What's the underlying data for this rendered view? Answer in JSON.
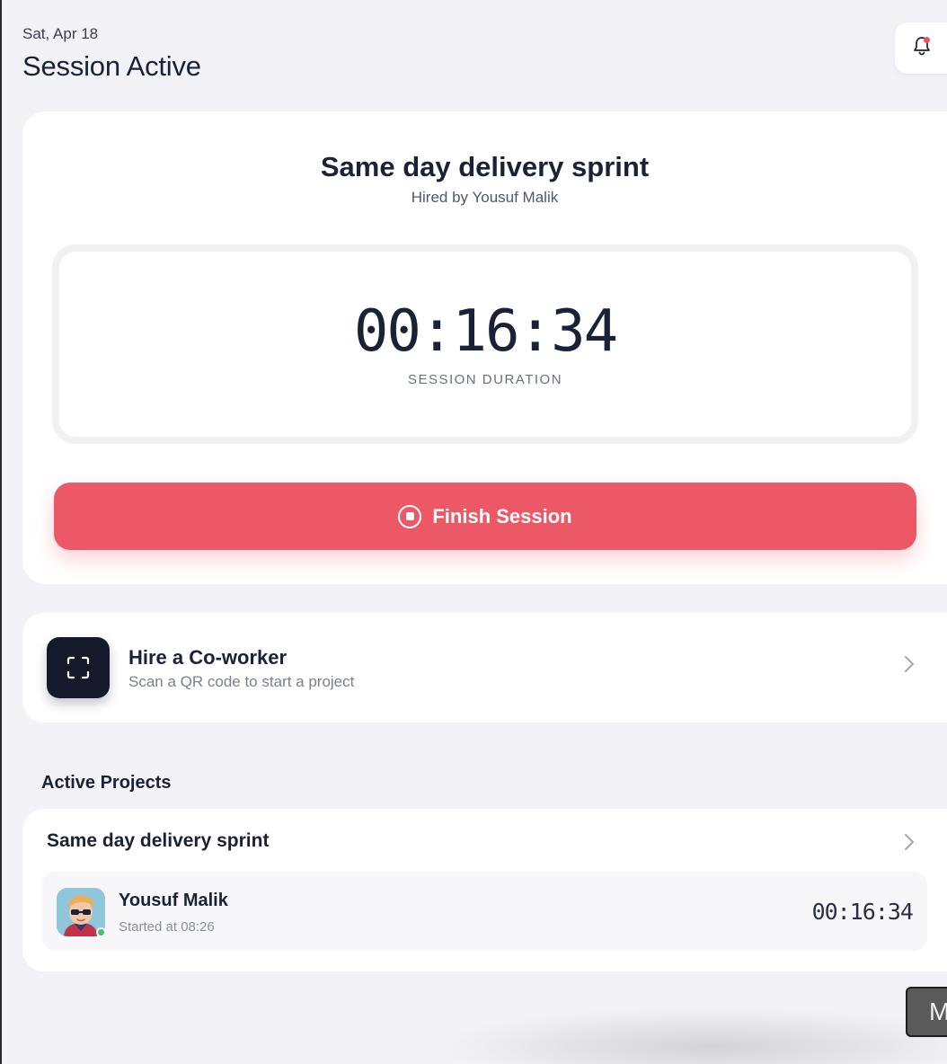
{
  "header": {
    "date": "Sat, Apr 18",
    "title": "Session Active"
  },
  "session": {
    "project_title": "Same day delivery sprint",
    "hired_by": "Hired by Yousuf Malik",
    "timer": "00:16:34",
    "timer_label": "SESSION DURATION",
    "finish_label": "Finish Session",
    "accent_color": "#ec5866"
  },
  "hire": {
    "title": "Hire a Co-worker",
    "subtitle": "Scan a QR code to start a project"
  },
  "active_projects": {
    "section_label": "Active Projects",
    "items": [
      {
        "name": "Same day delivery sprint",
        "worker": {
          "name": "Yousuf Malik",
          "started": "Started at 08:26",
          "elapsed": "00:16:34",
          "status_color": "#45c46a"
        }
      }
    ]
  },
  "overlay": {
    "m_label": "M"
  },
  "icons": {
    "notification": "bell-icon",
    "finish": "stop-circle-icon",
    "hire": "scan-frame-icon",
    "chevron": "chevron-right-icon"
  }
}
